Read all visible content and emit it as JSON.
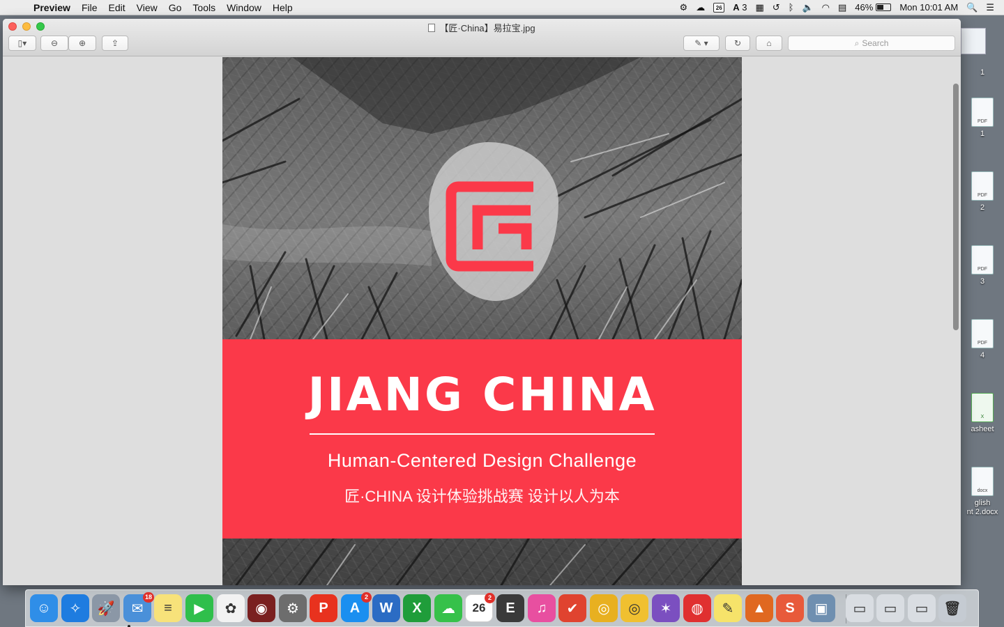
{
  "menubar": {
    "app_name": "Preview",
    "items": [
      "File",
      "Edit",
      "View",
      "Go",
      "Tools",
      "Window",
      "Help"
    ],
    "calendar_day": "26",
    "adobe_count": "3",
    "battery_percent": "46%",
    "clock": "Mon 10:01 AM"
  },
  "window": {
    "title": "【匠·China】易拉宝.jpg",
    "search_placeholder": "Search"
  },
  "poster": {
    "title": "JIANG CHINA",
    "subtitle": "Human-Centered Design Challenge",
    "chinese_line": "匠·CHINA 设计体验挑战赛 设计以人为本",
    "accent_color": "#fb3949"
  },
  "desktop": {
    "files": [
      {
        "badge": "",
        "caption": "1"
      },
      {
        "badge": "PDF",
        "caption": "1"
      },
      {
        "badge": "PDF",
        "caption": "2"
      },
      {
        "badge": "PDF",
        "caption": "3"
      },
      {
        "badge": "PDF",
        "caption": "4"
      },
      {
        "badge": "X",
        "caption": "asheet"
      },
      {
        "badge": "docx",
        "caption": "glish\nnt 2.docx"
      }
    ]
  },
  "dock": {
    "apps": [
      {
        "name": "finder",
        "glyph": "☺",
        "color": "#2f8ee8"
      },
      {
        "name": "safari",
        "glyph": "✧",
        "color": "#1e7ce0"
      },
      {
        "name": "launchpad",
        "glyph": "🚀",
        "color": "#8b97a6"
      },
      {
        "name": "mail",
        "glyph": "✉",
        "color": "#4a90d9",
        "badge": "18"
      },
      {
        "name": "notes",
        "glyph": "≡",
        "color": "#f7e27a"
      },
      {
        "name": "facetime",
        "glyph": "▶",
        "color": "#2fbf4b"
      },
      {
        "name": "photos",
        "glyph": "✿",
        "color": "#f2f2f2"
      },
      {
        "name": "photo-booth",
        "glyph": "◉",
        "color": "#7a2020"
      },
      {
        "name": "system-preferences",
        "glyph": "⚙",
        "color": "#6d6d6d"
      },
      {
        "name": "polaris",
        "glyph": "P",
        "color": "#e8321e"
      },
      {
        "name": "app-store",
        "glyph": "A",
        "color": "#1a8ff0",
        "badge": "2"
      },
      {
        "name": "word",
        "glyph": "W",
        "color": "#2b6cc4"
      },
      {
        "name": "excel",
        "glyph": "X",
        "color": "#1f9d3a"
      },
      {
        "name": "wechat",
        "glyph": "☁",
        "color": "#36c14a"
      },
      {
        "name": "calendar",
        "glyph": "26",
        "color": "#ffffff",
        "badge": "2"
      },
      {
        "name": "evernote",
        "glyph": "E",
        "color": "#3a3a3a"
      },
      {
        "name": "itunes",
        "glyph": "♫",
        "color": "#e84fa0"
      },
      {
        "name": "todoist",
        "glyph": "✔",
        "color": "#e0432f"
      },
      {
        "name": "chrome",
        "glyph": "◎",
        "color": "#e8b020"
      },
      {
        "name": "chrome-canary",
        "glyph": "◎",
        "color": "#f0c030"
      },
      {
        "name": "github",
        "glyph": "✶",
        "color": "#7b4fc0"
      },
      {
        "name": "netease-music",
        "glyph": "◍",
        "color": "#e03030"
      },
      {
        "name": "stickies",
        "glyph": "✎",
        "color": "#f6e36a"
      },
      {
        "name": "matlab",
        "glyph": "▲",
        "color": "#e06820"
      },
      {
        "name": "slides",
        "glyph": "S",
        "color": "#e85a3a"
      },
      {
        "name": "preview",
        "glyph": "▣",
        "color": "#6f8fb0"
      },
      {
        "name": "stack-screenshots-1",
        "glyph": "▭",
        "color": "#d9dde2"
      },
      {
        "name": "stack-screenshots-2",
        "glyph": "▭",
        "color": "#d9dde2"
      },
      {
        "name": "stack-screenshots-3",
        "glyph": "▭",
        "color": "#d9dde2"
      },
      {
        "name": "trash",
        "glyph": "🗑",
        "color": "#c5cbd2"
      }
    ]
  }
}
